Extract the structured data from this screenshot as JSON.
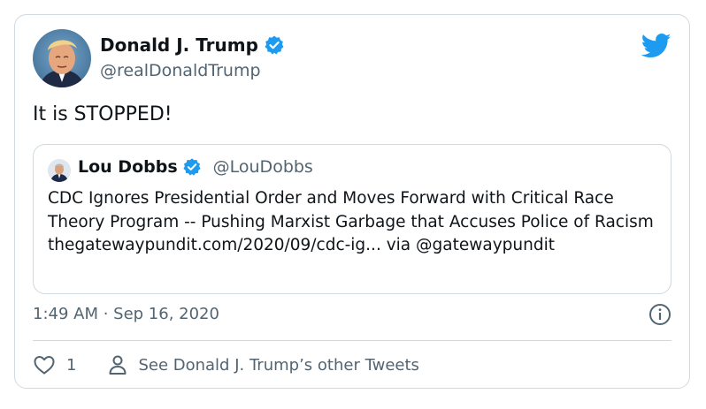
{
  "author": {
    "name": "Donald J. Trump",
    "handle": "@realDonaldTrump",
    "verified": true
  },
  "tweet": {
    "text": "It is STOPPED!",
    "timestamp": "1:49 AM · Sep 16, 2020",
    "likes": "1"
  },
  "quoted_tweet": {
    "name": "Lou Dobbs",
    "handle": "@LouDobbs",
    "verified": true,
    "text": "CDC Ignores Presidential Order and Moves Forward with Critical Race Theory Program -- Pushing Marxist Garbage that Accuses Police of Racism thegatewaypundit.com/2020/09/cdc-ig... via @gatewaypundit"
  },
  "actions": {
    "other_tweets_label": "See Donald J. Trump’s other Tweets"
  },
  "icons": {
    "bird": "twitter-bird-icon",
    "verified": "verified-badge-icon",
    "info": "info-icon",
    "like": "heart-icon",
    "profile": "person-icon"
  },
  "colors": {
    "brand": "#1d9bf0",
    "text": "#0f1419",
    "secondary": "#536471",
    "border": "#cfd9de"
  }
}
